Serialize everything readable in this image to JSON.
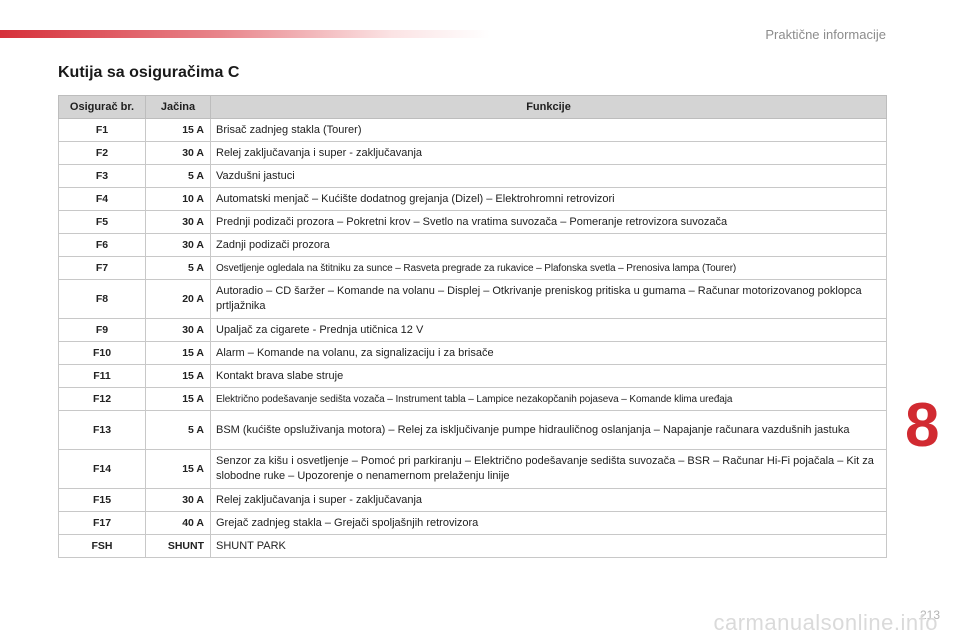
{
  "header": {
    "section_label": "Praktične informacije",
    "page_title": "Kutija sa osiguračima C"
  },
  "table": {
    "columns": [
      "Osigurač br.",
      "Jačina",
      "Funkcije"
    ],
    "rows": [
      {
        "fuse": "F1",
        "rating": "15 A",
        "function": "Brisač zadnjeg stakla (Tourer)"
      },
      {
        "fuse": "F2",
        "rating": "30 A",
        "function": "Relej zaključavanja i super - zaključavanja"
      },
      {
        "fuse": "F3",
        "rating": "5 A",
        "function": "Vazdušni jastuci"
      },
      {
        "fuse": "F4",
        "rating": "10 A",
        "function": "Automatski menjač – Kućište dodatnog grejanja (Dizel) – Elektrohromni retrovizori"
      },
      {
        "fuse": "F5",
        "rating": "30 A",
        "function": "Prednji podizači prozora – Pokretni krov – Svetlo na vratima suvozača – Pomeranje retrovizora suvozača"
      },
      {
        "fuse": "F6",
        "rating": "30 A",
        "function": "Zadnji podizači prozora"
      },
      {
        "fuse": "F7",
        "rating": "5 A",
        "function": "Osvetljenje ogledala na štitniku za sunce – Rasveta pregrade za rukavice – Plafonska svetla – Prenosiva lampa (Tourer)"
      },
      {
        "fuse": "F8",
        "rating": "20 A",
        "function": "Autoradio – CD šaržer – Komande na volanu – Displej – Otkrivanje preniskog pritiska u gumama – Računar motorizovanog poklopca prtljažnika"
      },
      {
        "fuse": "F9",
        "rating": "30 A",
        "function": "Upaljač za cigarete - Prednja utičnica 12 V"
      },
      {
        "fuse": "F10",
        "rating": "15 A",
        "function": "Alarm – Komande na volanu, za signalizaciju i za brisače"
      },
      {
        "fuse": "F11",
        "rating": "15 A",
        "function": "Kontakt brava slabe struje"
      },
      {
        "fuse": "F12",
        "rating": "15 A",
        "function": "Električno podešavanje sedišta vozača – Instrument tabla – Lampice nezakopčanih pojaseva – Komande klima uređaja"
      },
      {
        "fuse": "F13",
        "rating": "5 A",
        "function": "BSM (kućište opsluživanja motora) – Relej za isključivanje pumpe hidrauličnog oslanjanja – Napajanje računara vazdušnih jastuka"
      },
      {
        "fuse": "F14",
        "rating": "15 A",
        "function": "Senzor za kišu i osvetljenje – Pomoć pri parkiranju – Električno podešavanje sedišta suvozača – BSR – Računar Hi-Fi pojačala – Kit za slobodne ruke – Upozorenje o nenamernom prelaženju linije"
      },
      {
        "fuse": "F15",
        "rating": "30 A",
        "function": "Relej zaključavanja i super - zaključavanja"
      },
      {
        "fuse": "F17",
        "rating": "40 A",
        "function": "Grejač zadnjeg stakla – Grejači spoljašnjih retrovizora"
      },
      {
        "fuse": "FSH",
        "rating": "SHUNT",
        "function": "SHUNT PARK"
      }
    ]
  },
  "chapter_number": "8",
  "footer": {
    "page_number": "213",
    "watermark": "carmanualsonline.info"
  }
}
